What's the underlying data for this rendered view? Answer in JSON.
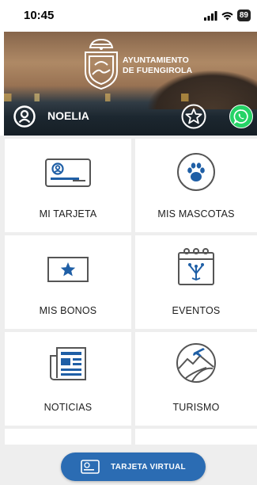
{
  "status_bar": {
    "time": "10:45",
    "battery": "89",
    "icons": [
      "signal-icon",
      "wifi-icon",
      "battery-icon"
    ]
  },
  "header": {
    "org_line1": "AYUNTAMIENTO",
    "org_line2": "DE FUENGIROLA",
    "user_name": "NOELIA",
    "icons": [
      "crest-icon",
      "user-icon",
      "star-icon",
      "whatsapp-icon"
    ]
  },
  "menu": {
    "items": [
      {
        "label": "MI TARJETA",
        "icon": "id-card-icon"
      },
      {
        "label": "MIS MASCOTAS",
        "icon": "paw-icon"
      },
      {
        "label": "MIS BONOS",
        "icon": "voucher-star-icon"
      },
      {
        "label": "EVENTOS",
        "icon": "calendar-event-icon"
      },
      {
        "label": "NOTICIAS",
        "icon": "newspaper-icon"
      },
      {
        "label": "TURISMO",
        "icon": "tourism-icon"
      }
    ]
  },
  "bottom": {
    "virtual_card_label": "TARJETA VIRTUAL",
    "icon": "card-icon"
  },
  "colors": {
    "accent": "#2b6cb3",
    "icon_blue": "#1f5fa6",
    "icon_gray": "#555555",
    "whatsapp": "#25d366",
    "grid_bg": "#eeeeee"
  }
}
